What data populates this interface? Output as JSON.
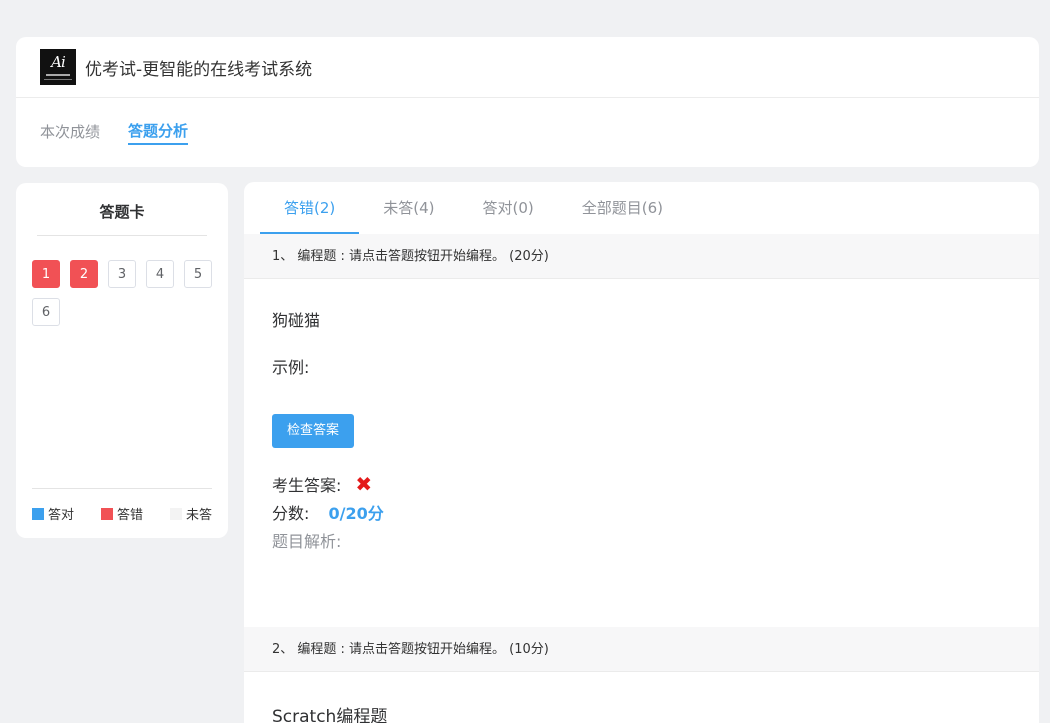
{
  "app": {
    "title": "优考试-更智能的在线考试系统"
  },
  "header_tabs": [
    {
      "label": "本次成绩"
    },
    {
      "label": "答题分析"
    }
  ],
  "answer_card": {
    "title": "答题卡",
    "numbers": [
      "1",
      "2",
      "3",
      "4",
      "5",
      "6"
    ],
    "legend": [
      {
        "label": "答对",
        "color": "#3ca0ee"
      },
      {
        "label": "答错",
        "color": "#f15155"
      },
      {
        "label": "未答",
        "color": "#f3f3f3"
      }
    ]
  },
  "tabs": [
    {
      "label": "答错(2)"
    },
    {
      "label": "未答(4)"
    },
    {
      "label": "答对(0)"
    },
    {
      "label": "全部题目(6)"
    }
  ],
  "questions": [
    {
      "header": "1、 编程题 : 请点击答题按钮开始编程。 (20分)",
      "title": "狗碰猫",
      "example_label": "示例:",
      "check_button": "检查答案",
      "answer_label": "考生答案:",
      "answer_mark": "✖",
      "score_label": "分数:",
      "score_value": "0/20分",
      "analysis_label": "题目解析:"
    },
    {
      "header": "2、 编程题 : 请点击答题按钮开始编程。 (10分)",
      "title": "Scratch编程题"
    }
  ]
}
